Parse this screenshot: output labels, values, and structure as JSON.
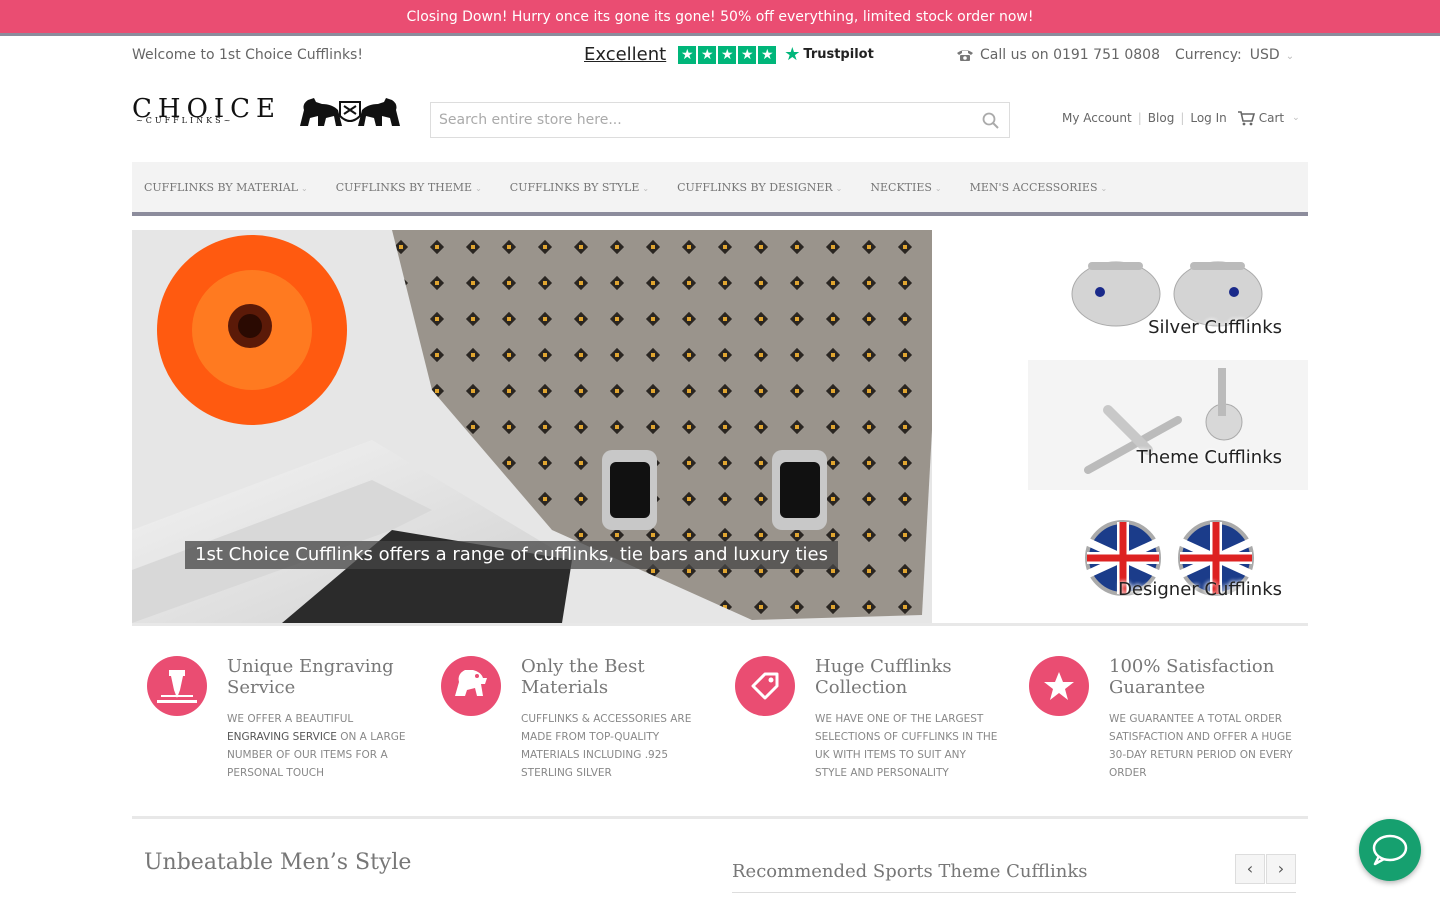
{
  "banner": {
    "text": "Closing Down! Hurry once its gone its gone! 50% off everything, limited stock order now!"
  },
  "topbar": {
    "welcome": "Welcome to 1st Choice Cufflinks!",
    "trustpilot_rating": "Excellent",
    "trustpilot_brand": "Trustpilot",
    "phone_text": "Call us on 0191 751 0808",
    "currency_label": "Currency:",
    "currency_value": "USD"
  },
  "logo": {
    "main": "CHOICE",
    "sub": "~CUFFLINKS~"
  },
  "search": {
    "placeholder": "Search entire store here...",
    "value": ""
  },
  "account": {
    "my_account": "My Account",
    "blog": "Blog",
    "login": "Log In",
    "cart": "Cart"
  },
  "nav": {
    "items": [
      {
        "label": "Cufflinks by Material"
      },
      {
        "label": "Cufflinks by Theme"
      },
      {
        "label": "Cufflinks by Style"
      },
      {
        "label": "Cufflinks by Designer"
      },
      {
        "label": "Neckties"
      },
      {
        "label": "Men's Accessories"
      }
    ]
  },
  "hero": {
    "caption": "1st Choice Cufflinks offers a range of cufflinks, tie bars and luxury ties"
  },
  "promos": [
    {
      "label": "Silver Cufflinks"
    },
    {
      "label": "Theme Cufflinks"
    },
    {
      "label": "Designer Cufflinks"
    }
  ],
  "features": [
    {
      "title": "Unique Engraving Service",
      "body_pre": "We offer a beautiful ",
      "body_em": "engraving service",
      "body_post": " on a large number of our items for a personal touch",
      "icon": "engraving-icon"
    },
    {
      "title": "Only the Best Materials",
      "body": "Cufflinks & accessories are made from top-quality materials including .925 sterling silver",
      "icon": "lion-crest-icon"
    },
    {
      "title": "Huge Cufflinks Collection",
      "body": "We have one of the largest selections of cufflinks in the UK with items to suit any style and personality",
      "icon": "tag-icon"
    },
    {
      "title": "100% Satisfaction Guarantee",
      "body": "We guarantee a total order satisfaction and offer a huge 30-day return period on every order",
      "icon": "star-icon"
    }
  ],
  "sections": {
    "style_title": "Unbeatable Men’s Style",
    "recommended_title": "Recommended Sports Theme Cufflinks",
    "prev": "‹",
    "next": "›"
  },
  "colors": {
    "accent": "#ea4d72",
    "nav_border": "#8c8c9c",
    "trustpilot": "#00b67a",
    "chat": "#16a06f"
  }
}
